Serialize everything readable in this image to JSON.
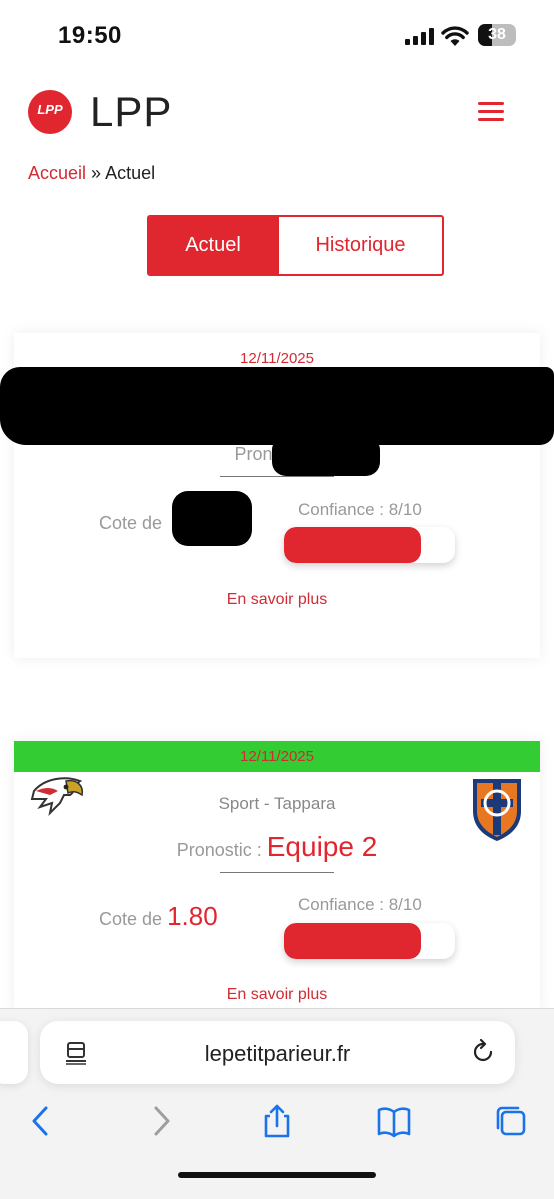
{
  "status_bar": {
    "time": "19:50",
    "battery": "38"
  },
  "header": {
    "logo_text": "LPP",
    "brand": "LPP"
  },
  "breadcrumb": {
    "home": "Accueil",
    "separator": "»",
    "current": "Actuel"
  },
  "tabs": {
    "active": "Actuel",
    "inactive": "Historique"
  },
  "cards": [
    {
      "date": "12/11/2025",
      "prono_label": "Pronostic :",
      "cote_label": "Cote de",
      "confidence_label": "Confiance : 8/10",
      "confidence": 0.8,
      "more": "En savoir plus"
    },
    {
      "date": "12/11/2025",
      "teams": "Sport - Tappara",
      "prono_label": "Pronostic :",
      "prono_value": "Equipe 2",
      "cote_label": "Cote de",
      "cote_value": "1.80",
      "confidence_label": "Confiance : 8/10",
      "confidence": 0.8,
      "more": "En savoir plus"
    }
  ],
  "browser": {
    "url": "lepetitparieur.fr"
  },
  "colors": {
    "accent": "#e0262f",
    "band_green": "#33cc33"
  }
}
